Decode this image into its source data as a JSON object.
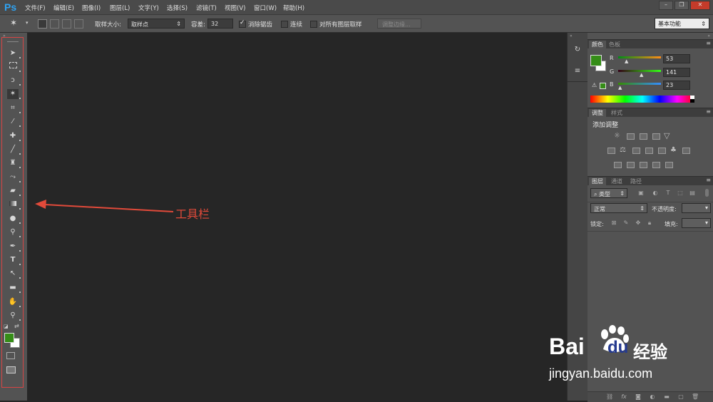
{
  "app": {
    "logo": "Ps"
  },
  "menu": {
    "items": [
      "文件(F)",
      "编辑(E)",
      "图像(I)",
      "图层(L)",
      "文字(Y)",
      "选择(S)",
      "滤镜(T)",
      "视图(V)",
      "窗口(W)",
      "帮助(H)"
    ]
  },
  "window_controls": {
    "minimize": "–",
    "restore": "❐",
    "close": "✕"
  },
  "options": {
    "sample_size_label": "取样大小:",
    "sample_size_value": "取样点",
    "tolerance_label": "容差:",
    "tolerance_value": "32",
    "antialias_label": "消除锯齿",
    "antialias_checked": true,
    "contiguous_label": "连续",
    "contiguous_checked": false,
    "sample_all_label": "对所有图层取样",
    "sample_all_checked": false,
    "refine_edge_label": "调整边缘...",
    "workspace_value": "基本功能"
  },
  "toolbox": {
    "tools": [
      "move-tool",
      "marquee-tool",
      "lasso-tool",
      "magic-wand-tool",
      "crop-tool",
      "eyedropper-tool",
      "healing-brush-tool",
      "brush-tool",
      "clone-stamp-tool",
      "history-brush-tool",
      "eraser-tool",
      "gradient-tool",
      "blur-tool",
      "dodge-tool",
      "pen-tool",
      "type-tool",
      "path-selection-tool",
      "rectangle-tool",
      "hand-tool",
      "zoom-tool"
    ]
  },
  "annotation": {
    "label": "工具栏",
    "color": "#e14a3a"
  },
  "colors": {
    "foreground": "#358d17",
    "background": "#ffffff",
    "accent": "#2fa3f2",
    "annotation_red": "#d84545"
  },
  "color_panel": {
    "tabs": [
      "颜色",
      "色板"
    ],
    "channels": [
      {
        "label": "R",
        "value": "53"
      },
      {
        "label": "G",
        "value": "141"
      },
      {
        "label": "B",
        "value": "23"
      }
    ]
  },
  "adjust_panel": {
    "tabs": [
      "调整",
      "样式"
    ],
    "title": "添加调整"
  },
  "layers_panel": {
    "tabs": [
      "图层",
      "通道",
      "路径"
    ],
    "filter_label": "类型",
    "blend_mode": "正常",
    "opacity_label": "不透明度:",
    "lock_label": "锁定:",
    "fill_label": "填充:"
  },
  "watermark": {
    "brand": "Bai",
    "brand2": "du",
    "jingyan": "经验",
    "url": "jingyan.baidu.com"
  }
}
